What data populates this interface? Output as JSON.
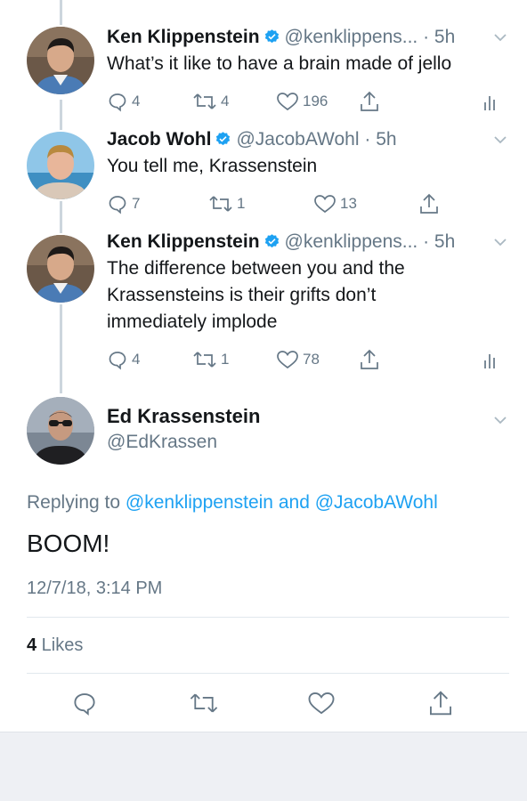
{
  "tweets": [
    {
      "name": "Ken Klippenstein",
      "handle": "@kenklippens...",
      "time": " · 5h",
      "text": "What’s it like to have a brain made of jello",
      "replies": "4",
      "retweets": "4",
      "likes": "196",
      "avatar_icon": "person-avatar-icon"
    },
    {
      "name": "Jacob Wohl",
      "handle": "@JacobAWohl",
      "time": " · 5h",
      "text": "You tell me, Krassenstein",
      "replies": "7",
      "retweets": "1",
      "likes": "13",
      "avatar_icon": "person-avatar-icon"
    },
    {
      "name": "Ken Klippenstein",
      "handle": "@kenklippens...",
      "time": " · 5h",
      "text_lines": [
        "The difference between you and the",
        "Krassensteins is their grifts don’t",
        "immediately implode"
      ],
      "replies": "4",
      "retweets": "1",
      "likes": "78",
      "avatar_icon": "person-avatar-icon"
    }
  ],
  "main_tweet": {
    "name": "Ed Krassenstein",
    "handle": "@EdKrassen",
    "replying_prefix": "Replying to ",
    "replying_user1": "@kenklippenstein",
    "replying_and": " and ",
    "replying_user2": "@JacobAWohl",
    "text": "BOOM!",
    "timestamp": "12/7/18, 3:14 PM",
    "likes_count": "4",
    "likes_label": " Likes"
  },
  "colors": {
    "link": "#1da1f2",
    "verified": "#1da1f2",
    "secondary_text": "#657786"
  }
}
